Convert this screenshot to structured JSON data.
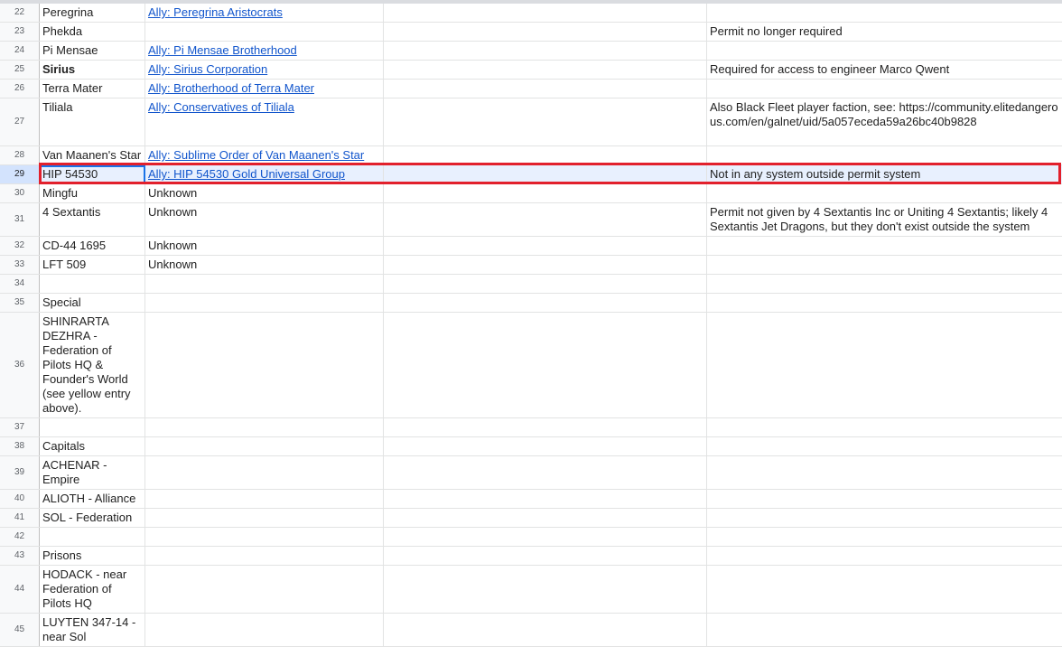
{
  "rows": [
    {
      "num": "22",
      "a": "Peregrina",
      "b": "Ally: Peregrina Aristocrats",
      "d": ""
    },
    {
      "num": "23",
      "a": "Phekda",
      "b": "",
      "d": "Permit no longer required"
    },
    {
      "num": "24",
      "a": "Pi Mensae",
      "b": "Ally: Pi Mensae Brotherhood",
      "d": ""
    },
    {
      "num": "25",
      "a": "Sirius",
      "b": "Ally: Sirius Corporation",
      "d": "Required for access to engineer Marco Qwent"
    },
    {
      "num": "26",
      "a": "Terra Mater",
      "b": "Ally: Brotherhood of Terra Mater",
      "d": ""
    },
    {
      "num": "27",
      "a": "Tiliala",
      "b": "Ally: Conservatives of Tiliala",
      "d": "Also Black Fleet player faction, see: https://community.elitedangerous.com/en/galnet/uid/5a057eceda59a26bc40b9828"
    },
    {
      "num": "28",
      "a": "Van Maanen's Star",
      "b": "Ally: Sublime Order of Van Maanen's Star",
      "d": ""
    },
    {
      "num": "29",
      "a": "HIP 54530",
      "b": "Ally: HIP 54530 Gold Universal Group",
      "d": "Not in any system outside permit system"
    },
    {
      "num": "30",
      "a": "Mingfu",
      "b": "Unknown",
      "d": ""
    },
    {
      "num": "31",
      "a": "4 Sextantis",
      "b": "Unknown",
      "d": "Permit not given by 4 Sextantis Inc or Uniting 4 Sextantis; likely 4 Sextantis Jet Dragons, but they don't exist outside the system"
    },
    {
      "num": "32",
      "a": "CD-44 1695",
      "b": "Unknown",
      "d": ""
    },
    {
      "num": "33",
      "a": "LFT 509",
      "b": "Unknown",
      "d": ""
    },
    {
      "num": "34",
      "a": "",
      "b": "",
      "d": ""
    },
    {
      "num": "35",
      "a": "Special",
      "b": "",
      "d": ""
    },
    {
      "num": "36",
      "a": "SHINRARTA DEZHRA - Federation of Pilots HQ & Founder's World (see yellow entry above).",
      "b": "",
      "d": ""
    },
    {
      "num": "37",
      "a": "",
      "b": "",
      "d": ""
    },
    {
      "num": "38",
      "a": "Capitals",
      "b": "",
      "d": ""
    },
    {
      "num": "39",
      "a": "ACHENAR - Empire",
      "b": "",
      "d": ""
    },
    {
      "num": "40",
      "a": "ALIOTH - Alliance",
      "b": "",
      "d": ""
    },
    {
      "num": "41",
      "a": "SOL - Federation",
      "b": "",
      "d": ""
    },
    {
      "num": "42",
      "a": "",
      "b": "",
      "d": ""
    },
    {
      "num": "43",
      "a": "Prisons",
      "b": "",
      "d": ""
    },
    {
      "num": "44",
      "a": "HODACK - near Federation of Pilots HQ",
      "b": "",
      "d": ""
    },
    {
      "num": "45",
      "a": "LUYTEN 347-14 - near Sol",
      "b": "",
      "d": ""
    }
  ],
  "colors": {
    "link": "#1155cc",
    "highlight": "#e2202c",
    "selection": "#1a73e8"
  }
}
